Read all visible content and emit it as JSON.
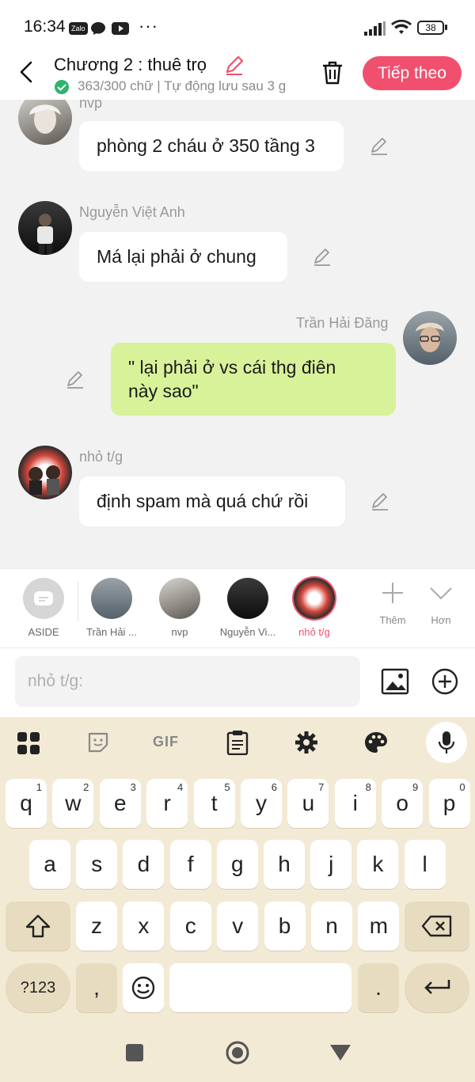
{
  "status_bar": {
    "time": "16:34",
    "zalo_label": "Zalo",
    "battery": "38"
  },
  "header": {
    "title": "Chương 2 : thuê trọ",
    "subtitle": "363/300 chữ | Tự động lưu sau 3 g",
    "next_button": "Tiếp theo"
  },
  "messages": [
    {
      "sender": "nvp",
      "text": "phòng 2 cháu ở 350 tầng 3"
    },
    {
      "sender": "Nguyễn Việt Anh",
      "text": "Má lại phải ở chung"
    },
    {
      "sender": "Trần Hải Đăng",
      "text_line1": "\" lại phải ở vs cái thg điên",
      "text_line2": "này sao\""
    },
    {
      "sender": "nhỏ t/g",
      "text": "định spam mà quá chứ rồi"
    }
  ],
  "character_bar": {
    "aside": "ASIDE",
    "characters": [
      "Trần Hải ...",
      "nvp",
      "Nguyễn Vi...",
      "nhỏ t/g"
    ],
    "add_label": "Thêm",
    "more_label": "Hơn"
  },
  "input": {
    "placeholder": "nhỏ t/g:"
  },
  "keyboard": {
    "gif_label": "GIF",
    "row1": [
      "q",
      "w",
      "e",
      "r",
      "t",
      "y",
      "u",
      "i",
      "o",
      "p"
    ],
    "row1_hints": [
      "1",
      "2",
      "3",
      "4",
      "5",
      "6",
      "7",
      "8",
      "9",
      "0"
    ],
    "row2": [
      "a",
      "s",
      "d",
      "f",
      "g",
      "h",
      "j",
      "k",
      "l"
    ],
    "row3": [
      "z",
      "x",
      "c",
      "v",
      "b",
      "n",
      "m"
    ],
    "numbers_key": "?123",
    "comma_key": ",",
    "period_key": "."
  },
  "colors": {
    "accent": "#f0506e",
    "green_bubble": "#d8f29a",
    "keyboard_bg": "#f3ead6"
  },
  "icons": [
    "back-icon",
    "pencil-icon",
    "trash-icon",
    "check-icon",
    "image-icon",
    "add-circle-icon",
    "plus-icon",
    "chevron-down-icon",
    "mic-icon",
    "backspace-icon",
    "enter-icon",
    "shift-icon",
    "emoji-icon"
  ]
}
